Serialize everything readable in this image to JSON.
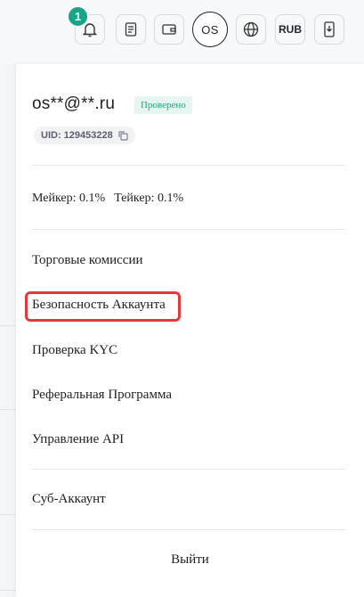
{
  "header": {
    "notification_count": "1",
    "avatar_initials": "OS",
    "currency": "RUB",
    "icons": [
      "bell-icon",
      "orders-icon",
      "wallet-icon",
      "globe-icon",
      "download-icon"
    ]
  },
  "account": {
    "email": "os**@**.ru",
    "verified_label": "Проверено",
    "uid_label": "UID: 129453228",
    "maker_fee": "Мейкер: 0.1%",
    "taker_fee": "Тейкер: 0.1%"
  },
  "menu": {
    "items": [
      "Торговые комиссии",
      "Безопасность Аккаунта",
      "Проверка KYC",
      "Реферальная Программа",
      "Управление API",
      "Суб-Аккаунт"
    ],
    "logout_label": "Выйти"
  },
  "colors": {
    "accent": "#17a488",
    "highlight": "#e0393e",
    "verified_text": "#1fa47f"
  }
}
